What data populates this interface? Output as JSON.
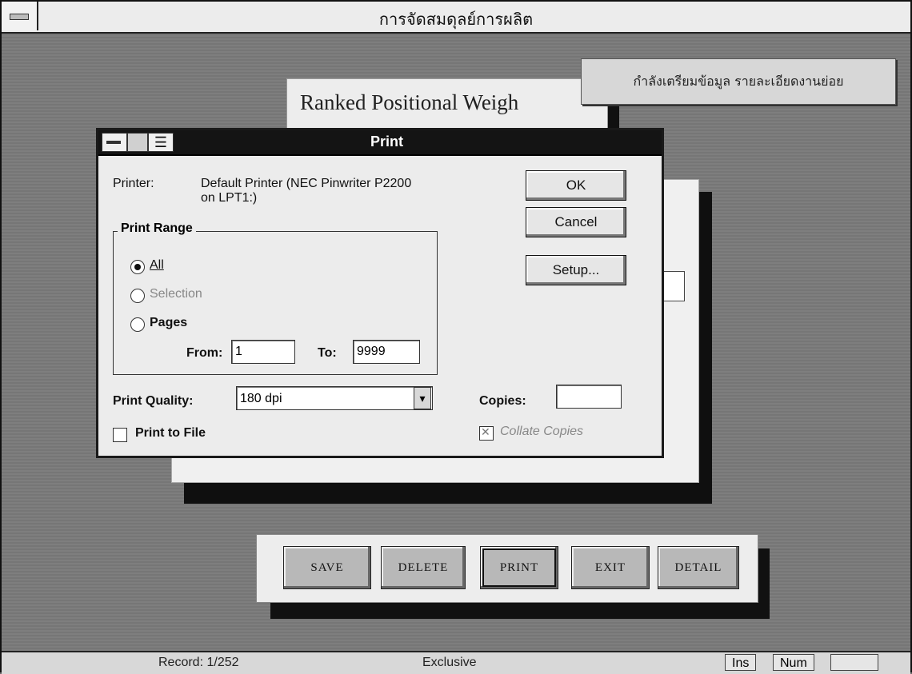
{
  "app": {
    "title": "การจัดสมดุลย์การผลิต"
  },
  "banner": {
    "text": "Ranked Positional Weigh"
  },
  "status_message": "กำลังเตรียมข้อมูล รายละเอียดงานย่อย",
  "print_dialog": {
    "title": "Print",
    "printer_label": "Printer:",
    "printer_value_line1": "Default Printer (NEC Pinwriter P2200",
    "printer_value_line2": "on LPT1:)",
    "ok": "OK",
    "cancel": "Cancel",
    "setup": "Setup...",
    "range_title": "Print Range",
    "range_all": "All",
    "range_selection": "Selection",
    "range_pages": "Pages",
    "from_label": "From:",
    "from_value": "1",
    "to_label": "To:",
    "to_value": "9999",
    "quality_label": "Print Quality:",
    "quality_value": "180 dpi",
    "copies_label": "Copies:",
    "copies_value": "",
    "print_to_file": "Print to File",
    "collate": "Collate Copies"
  },
  "toolbar": {
    "save": "SAVE",
    "delete": "DELETE",
    "print": "PRINT",
    "exit": "EXIT",
    "detail": "DETAIL"
  },
  "statusbar": {
    "record": "Record: 1/252",
    "mode": "Exclusive",
    "ins": "Ins",
    "num": "Num"
  },
  "icons": [
    "system-menu-icon",
    "dropdown-arrow-icon",
    "radio-selected-icon",
    "radio-icon",
    "checkbox-icon"
  ]
}
